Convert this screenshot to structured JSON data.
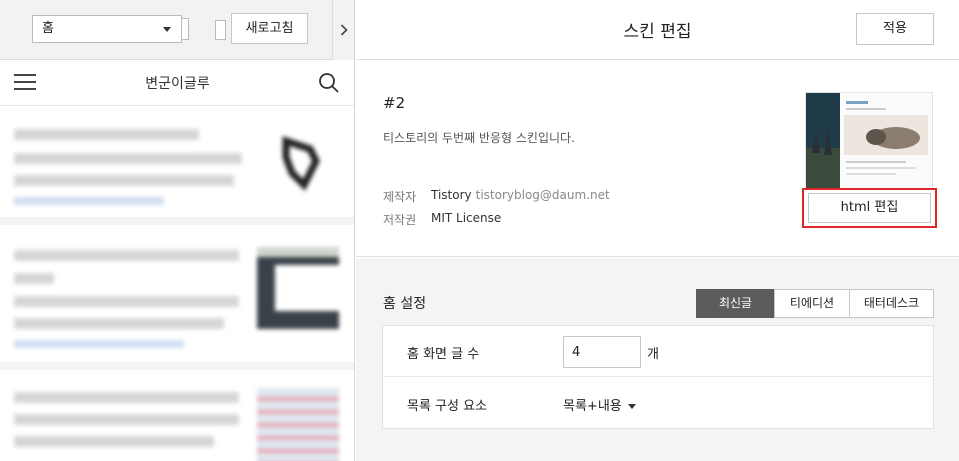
{
  "left": {
    "page_select": {
      "value": "홈"
    },
    "refresh_label": "새로고침",
    "blog_title": "변군이글루"
  },
  "editor": {
    "title": "스킨 편집",
    "apply_label": "적용",
    "skin": {
      "name": "#2",
      "description": "티스토리의 두번째 반응형 스킨입니다.",
      "author_label": "제작자",
      "author_name": "Tistory",
      "author_email": "tistoryblog@daum.net",
      "license_label": "저작권",
      "license_value": "MIT License",
      "html_edit_label": "html 편집"
    },
    "home": {
      "title": "홈 설정",
      "tabs": [
        {
          "label": "최신글",
          "active": true
        },
        {
          "label": "티에디션",
          "active": false
        },
        {
          "label": "태터데스크",
          "active": false
        }
      ],
      "post_count_label": "홈 화면 글 수",
      "post_count_value": "4",
      "post_count_unit": "개",
      "list_component_label": "목록 구성 요소",
      "list_component_value": "목록+내용"
    }
  },
  "colors": {
    "highlight": "#e0262b",
    "active_tab": "#5c5c5c",
    "panel_bg": "#f4f4f4"
  }
}
